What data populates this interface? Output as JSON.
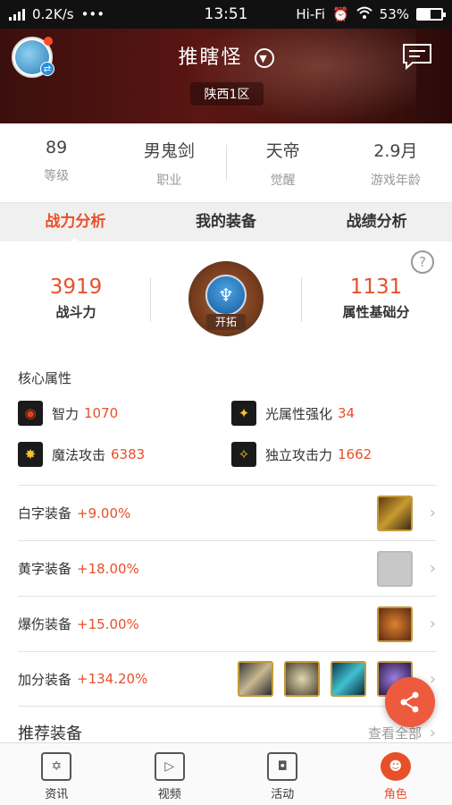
{
  "status": {
    "speed": "0.2K/s",
    "dots": "•••",
    "time": "13:51",
    "network": "Hi-Fi",
    "battery": "53%",
    "battery_level": 0.53
  },
  "header": {
    "character_name": "推瞎怪",
    "server": "陕西1区",
    "chevron_icon": "chevron-down-icon",
    "message_icon": "message-icon"
  },
  "stats": [
    {
      "value": "89",
      "label": "等级"
    },
    {
      "value": "男鬼剑",
      "label": "职业"
    },
    {
      "value": "天帝",
      "label": "觉醒"
    },
    {
      "value": "2.9月",
      "label": "游戏年龄"
    }
  ],
  "tabs": [
    {
      "label": "战力分析",
      "active": true
    },
    {
      "label": "我的装备",
      "active": false
    },
    {
      "label": "战绩分析",
      "active": false
    }
  ],
  "power": {
    "combat_value": "3919",
    "combat_label": "战斗力",
    "base_value": "1131",
    "base_label": "属性基础分",
    "badge_label": "开拓"
  },
  "core": {
    "title": "核心属性",
    "attrs": [
      {
        "name": "智力",
        "value": "1070"
      },
      {
        "name": "光属性强化",
        "value": "34"
      },
      {
        "name": "魔法攻击",
        "value": "6383"
      },
      {
        "name": "独立攻击力",
        "value": "1662"
      }
    ]
  },
  "equipment": [
    {
      "name": "白字装备",
      "pct": "+9.00%"
    },
    {
      "name": "黄字装备",
      "pct": "+18.00%"
    },
    {
      "name": "爆伤装备",
      "pct": "+15.00%"
    },
    {
      "name": "加分装备",
      "pct": "+134.20%"
    }
  ],
  "recommend": {
    "title": "推荐装备",
    "view_all": "查看全部"
  },
  "nav": [
    {
      "label": "资讯",
      "active": false
    },
    {
      "label": "视频",
      "active": false
    },
    {
      "label": "活动",
      "active": false
    },
    {
      "label": "角色",
      "active": true
    }
  ],
  "colors": {
    "accent": "#e8502a",
    "header_bg": "#4a1410"
  }
}
